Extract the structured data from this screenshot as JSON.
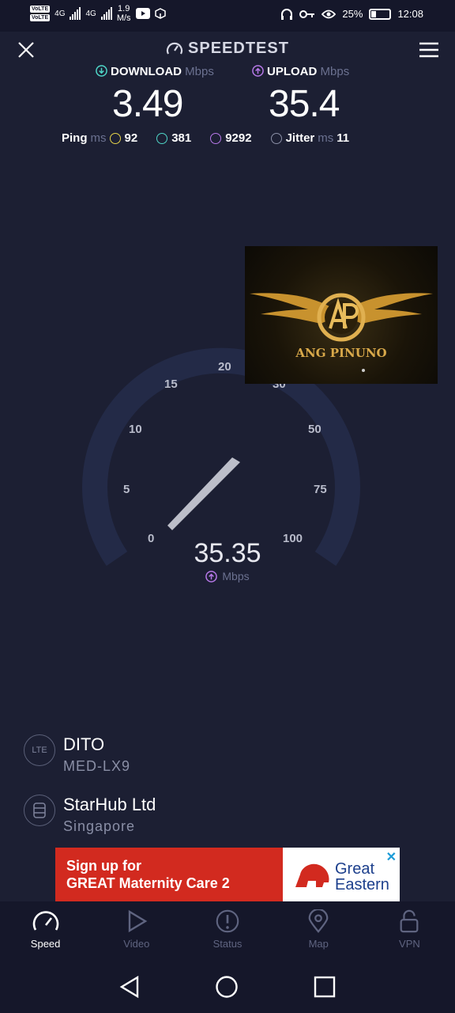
{
  "status_bar": {
    "sim1": "VoLTE",
    "sim2": "VoLTE",
    "net1": "4G",
    "net2": "4G",
    "net_speed": "1.9",
    "net_speed_unit": "M/s",
    "battery": "25%",
    "time": "12:08"
  },
  "header": {
    "title": "SPEEDTEST"
  },
  "download": {
    "label": "DOWNLOAD",
    "unit": "Mbps",
    "value": "3.49"
  },
  "upload": {
    "label": "UPLOAD",
    "unit": "Mbps",
    "value": "35.4"
  },
  "ping": {
    "label": "Ping",
    "unit": "ms",
    "idle": "92",
    "down": "381",
    "up": "9292",
    "jitter_label": "Jitter",
    "jitter_unit": "ms",
    "jitter": "11"
  },
  "gauge": {
    "ticks": [
      "0",
      "5",
      "10",
      "15",
      "20",
      "30",
      "50",
      "75",
      "100"
    ],
    "value": "35.35",
    "unit": "Mbps"
  },
  "overlay": {
    "brand": "ANG PINUNO"
  },
  "provider": {
    "name": "DITO",
    "device": "MED-LX9",
    "type": "LTE"
  },
  "server": {
    "name": "StarHub Ltd",
    "location": "Singapore"
  },
  "ad": {
    "line1": "Sign up for",
    "line2": "GREAT Maternity Care 2",
    "logo1": "Great",
    "logo2": "Eastern"
  },
  "tabs": [
    "Speed",
    "Video",
    "Status",
    "Map",
    "VPN"
  ],
  "colors": {
    "background": "#1c1f33",
    "download": "#4fd6c8",
    "upload": "#b678e8",
    "ad_red": "#d22a1f"
  }
}
